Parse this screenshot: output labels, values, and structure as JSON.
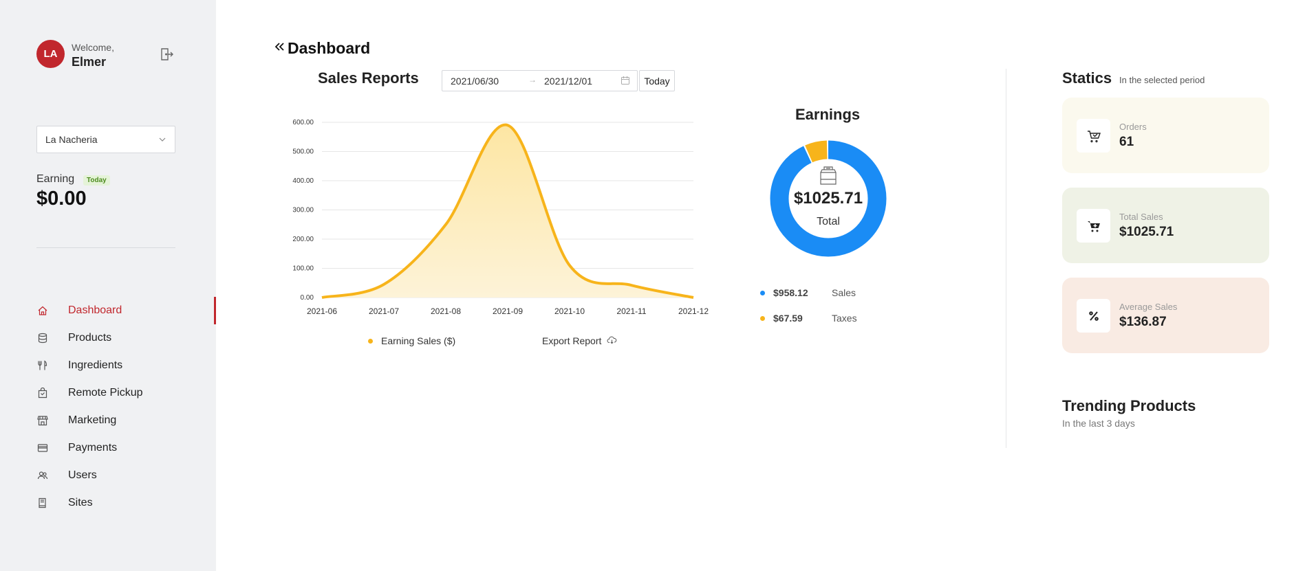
{
  "user": {
    "initials": "LA",
    "welcome": "Welcome,",
    "name": "Elmer"
  },
  "site_select": {
    "value": "La Nacheria"
  },
  "earning": {
    "label": "Earning",
    "badge": "Today",
    "value": "$0.00"
  },
  "nav": [
    {
      "label": "Dashboard",
      "icon": "home-icon",
      "active": true
    },
    {
      "label": "Products",
      "icon": "database-icon",
      "active": false
    },
    {
      "label": "Ingredients",
      "icon": "utensils-icon",
      "active": false
    },
    {
      "label": "Remote Pickup",
      "icon": "shopping-bag-icon",
      "active": false
    },
    {
      "label": "Marketing",
      "icon": "storefront-icon",
      "active": false
    },
    {
      "label": "Payments",
      "icon": "credit-card-icon",
      "active": false
    },
    {
      "label": "Users",
      "icon": "users-icon",
      "active": false
    },
    {
      "label": "Sites",
      "icon": "book-icon",
      "active": false
    }
  ],
  "page": {
    "title": "Dashboard"
  },
  "sales_report": {
    "title": "Sales Reports",
    "date_from": "2021/06/30",
    "date_to": "2021/12/01",
    "today_label": "Today",
    "legend_label": "Earning Sales ($)",
    "export_label": "Export Report"
  },
  "chart_data": {
    "type": "area",
    "x": [
      "2021-06",
      "2021-07",
      "2021-08",
      "2021-09",
      "2021-10",
      "2021-11",
      "2021-12"
    ],
    "y_ticks": [
      "0.00",
      "100.00",
      "200.00",
      "300.00",
      "400.00",
      "500.00",
      "600.00"
    ],
    "ylim": [
      0,
      600
    ],
    "series": [
      {
        "name": "Earning Sales ($)",
        "values": [
          0,
          45,
          250,
          590,
          110,
          42,
          0
        ]
      }
    ],
    "grid": true,
    "colors": {
      "line": "#f7b41b",
      "fill": "#fde9b0"
    }
  },
  "earnings": {
    "title": "Earnings",
    "total": "$1025.71",
    "total_label": "Total",
    "segments": [
      {
        "name": "Sales",
        "value": "$958.12",
        "amount": 958.12,
        "color": "#1a8cf5"
      },
      {
        "name": "Taxes",
        "value": "$67.59",
        "amount": 67.59,
        "color": "#f7b41b"
      }
    ]
  },
  "statics": {
    "title": "Statics",
    "subtitle": "In the selected period",
    "cards": [
      {
        "label": "Orders",
        "value": "61",
        "icon": "cart-icon",
        "bg": "#fbf9ee"
      },
      {
        "label": "Total Sales",
        "value": "$1025.71",
        "icon": "cart-plus-icon",
        "bg": "#eff2e6"
      },
      {
        "label": "Average Sales",
        "value": "$136.87",
        "icon": "percent-icon",
        "bg": "#f9ebe3"
      }
    ]
  },
  "trending": {
    "title": "Trending Products",
    "subtitle": "In the last 3 days"
  }
}
